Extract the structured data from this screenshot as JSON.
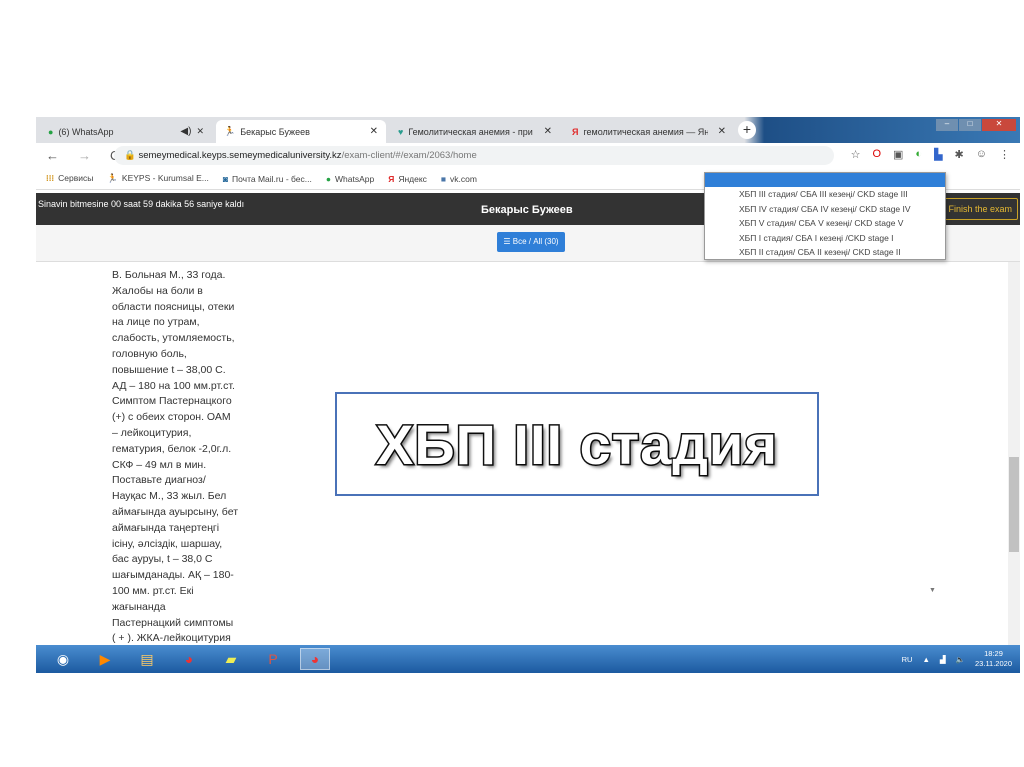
{
  "tabs": [
    {
      "label": "(6) WhatsApp",
      "icon": "whatsapp-icon",
      "audio": true
    },
    {
      "label": "Бекарыс Бужеев",
      "icon": "runner-icon"
    },
    {
      "label": "Гемолитическая анемия - при",
      "icon": "heart-icon"
    },
    {
      "label": "гемолитическая анемия — Янд",
      "icon": "yandex-icon"
    }
  ],
  "address": {
    "host": "semeymedical.keyps.semeymedicaluniversity.kz",
    "path": "/exam-client/#/exam/2063/home"
  },
  "bookmarks": [
    "Сервисы",
    "KEYPS - Kurumsal E...",
    "Почта Mail.ru - бес...",
    "WhatsApp",
    "Яндекс",
    "vk.com"
  ],
  "header": {
    "timer": "Sinavin bitmesine 00 saat 59 dakika 56 saniye kaldı",
    "student": "Бекарыс Бужеев",
    "finish": "Finish the exam"
  },
  "toolbar": {
    "all_button": "☰ Все / All (30)"
  },
  "question": {
    "lines": [
      "В. Больная М., 33 года.",
      "Жалобы на боли в",
      "области поясницы, отеки",
      "на лице по утрам,",
      "слабость, утомляемость,",
      "головную боль,",
      "повышение t – 38,00 С.",
      "АД – 180 на 100 мм.рт.ст.",
      "Симптом Пастернацкого",
      "(+) с обеих сторон. ОАМ",
      "– лейкоцитурия,",
      "гематурия, белок -2,0г.л.",
      "СКФ – 49 мл в мин.",
      "Поставьте диагноз/",
      "Науқас М., 33 жыл. Бел",
      "аймағында ауырсыну, бет",
      "аймағында таңертеңгі",
      "ісіну, әлсіздік, шаршау,",
      "бас ауруы, t – 38,0 С",
      "шағымданады. АҚ – 180-",
      "100 мм. рт.ст. Екі",
      "жағынанда",
      "Пастернацкий симптомы",
      "( + ). ЖКА-лейкоцитурия"
    ]
  },
  "dropdown": {
    "options": [
      "ХБП III стадия/ СБА III кезеңі/ CKD stage III",
      "ХБП IV стадия/ СБА IV кезеңі/ CKD stage IV",
      "ХБП V стадия/ СБА V кезеңі/ CKD stage V",
      "ХБП I стадия/ СБА I кезеңі /CKD stage I",
      "ХБП II стадия/ СБА II кезеңі/ CKD stage II"
    ]
  },
  "answer_callout": "ХБП III стадия",
  "tray": {
    "lang": "RU",
    "time": "18:29",
    "date": "23.11.2020"
  }
}
